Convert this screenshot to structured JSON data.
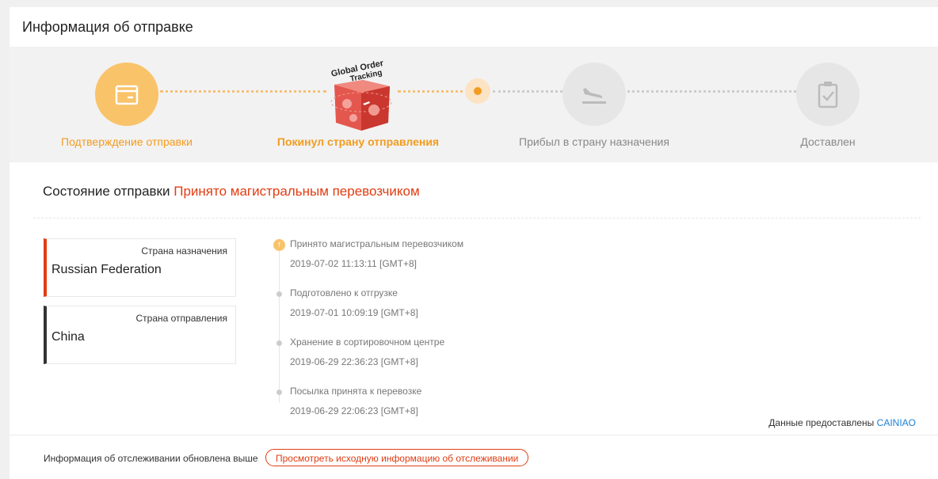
{
  "header": {
    "title": "Информация об отправке"
  },
  "steps": [
    {
      "label": "Подтверждение отправки",
      "icon": "package-icon",
      "state": "done"
    },
    {
      "label": "Покинул страну отправления",
      "icon": "global-order-tracking-box-icon",
      "state": "current",
      "badge_line1": "Global Order",
      "badge_line2": "Tracking"
    },
    {
      "label": "Прибыл в страну назначения",
      "icon": "plane-landing-icon",
      "state": "pending"
    },
    {
      "label": "Доставлен",
      "icon": "clipboard-check-icon",
      "state": "pending"
    }
  ],
  "status": {
    "label": "Состояние отправки",
    "value": "Принято магистральным перевозчиком"
  },
  "destination": {
    "label": "Страна назначения",
    "country": "Russian Federation"
  },
  "origin": {
    "label": "Страна отправления",
    "country": "China"
  },
  "events": [
    {
      "title": "Принято магистральным перевозчиком",
      "datetime": "2019-07-02 11:13:11 [GMT+8]"
    },
    {
      "title": "Подготовлено к отгрузке",
      "datetime": "2019-07-01 10:09:19 [GMT+8]"
    },
    {
      "title": "Хранение в сортировочном центре",
      "datetime": "2019-06-29 22:36:23 [GMT+8]"
    },
    {
      "title": "Посылка принята к перевозке",
      "datetime": "2019-06-29 22:06:23 [GMT+8]"
    }
  ],
  "provider": {
    "label": "Данные предоставлены",
    "name": "CAINIAO"
  },
  "footer": {
    "text": "Информация об отслеживании обновлена выше",
    "button_label": "Просмотреть исходную информацию об отслеживании"
  },
  "colors": {
    "accent": "#f39c1f",
    "status_red": "#e23c12",
    "link_blue": "#1a7fd4"
  }
}
